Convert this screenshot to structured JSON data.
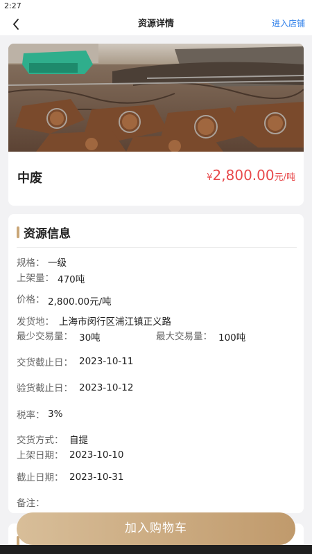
{
  "status": {
    "time": "2:27"
  },
  "nav": {
    "title": "资源详情",
    "store_link": "进入店铺"
  },
  "product": {
    "name": "中废",
    "price_symbol": "¥",
    "price": "2,800.00",
    "price_unit": "元/吨"
  },
  "info": {
    "section_title": "资源信息",
    "spec": {
      "label": "规格：",
      "value": "一级"
    },
    "listed_qty": {
      "label": "上架量：",
      "value": "470吨"
    },
    "unit_price": {
      "label": "价格：",
      "value": "2,800.00元/吨"
    },
    "ship_from": {
      "label": "发货地：",
      "value": "上海市闵行区浦江镇正义路"
    },
    "min_qty": {
      "label": "最少交易量：",
      "value": "30吨"
    },
    "max_qty": {
      "label": "最大交易量：",
      "value": "100吨"
    },
    "delivery_deadline": {
      "label": "交货截止日：",
      "value": "2023-10-11"
    },
    "inspection_deadline": {
      "label": "验货截止日：",
      "value": "2023-10-12"
    },
    "tax_rate": {
      "label": "税率：",
      "value": "3%"
    },
    "delivery_method": {
      "label": "交货方式：",
      "value": "自提"
    },
    "listed_date": {
      "label": "上架日期：",
      "value": "2023-10-10"
    },
    "end_date": {
      "label": "截止日期：",
      "value": "2023-10-31"
    },
    "remarks": {
      "label": "备注：",
      "value": ""
    }
  },
  "actions": {
    "add_to_cart": "加入购物车"
  },
  "colors": {
    "accent": "#c9a677",
    "price": "#e8494b",
    "link": "#2b7de9"
  }
}
